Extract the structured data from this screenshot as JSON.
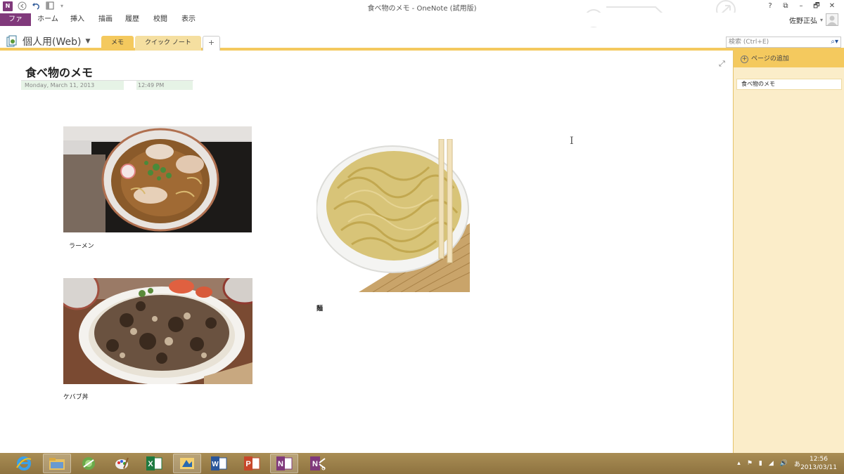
{
  "window": {
    "title": "食べ物のメモ - OneNote (試用版)",
    "help_label": "?",
    "ribbon_display_label": "⧉",
    "minimize_label": "–",
    "restore_label": "🗗",
    "close_label": "✕"
  },
  "ribbon": {
    "tabs": [
      "ファイル",
      "ホーム",
      "挿入",
      "描画",
      "履歴",
      "校閲",
      "表示"
    ]
  },
  "user": {
    "name": "佐野正弘",
    "dropdown": "▾"
  },
  "notebook": {
    "name": "個人用(Web)",
    "dropdown": "▼"
  },
  "sections": [
    "メモ",
    "クイック ノート",
    "+"
  ],
  "search": {
    "placeholder": "検索 (Ctrl+E)",
    "icon": "magnifier-icon"
  },
  "page": {
    "title": "食べ物のメモ",
    "date": "Monday, March 11, 2013",
    "time": "12:49 PM",
    "captions": {
      "ramen": "ラーメン",
      "noodles": "麺",
      "kebab": "ケバブ丼"
    },
    "expand_glyph": "⤢",
    "cursor_glyph": "I"
  },
  "pane": {
    "add_page": "ページの追加",
    "add_icon": "+",
    "pages": [
      "食べ物のメモ"
    ]
  },
  "taskbar": {
    "clock_time": "12:56",
    "clock_date": "2013/03/11",
    "tray_icons": [
      "▴",
      "⚑",
      "▮",
      "◢",
      "🔊",
      "あ"
    ],
    "apps": [
      "ie",
      "explorer",
      "recycle",
      "paint",
      "excel",
      "tool",
      "word",
      "powerpoint",
      "onenote",
      "onenote-clipper"
    ]
  },
  "colors": {
    "onenote_purple": "#80397b",
    "section_yellow": "#f4c95e",
    "pane_bg": "#fbedc9",
    "taskbar": "#9b7f48"
  }
}
